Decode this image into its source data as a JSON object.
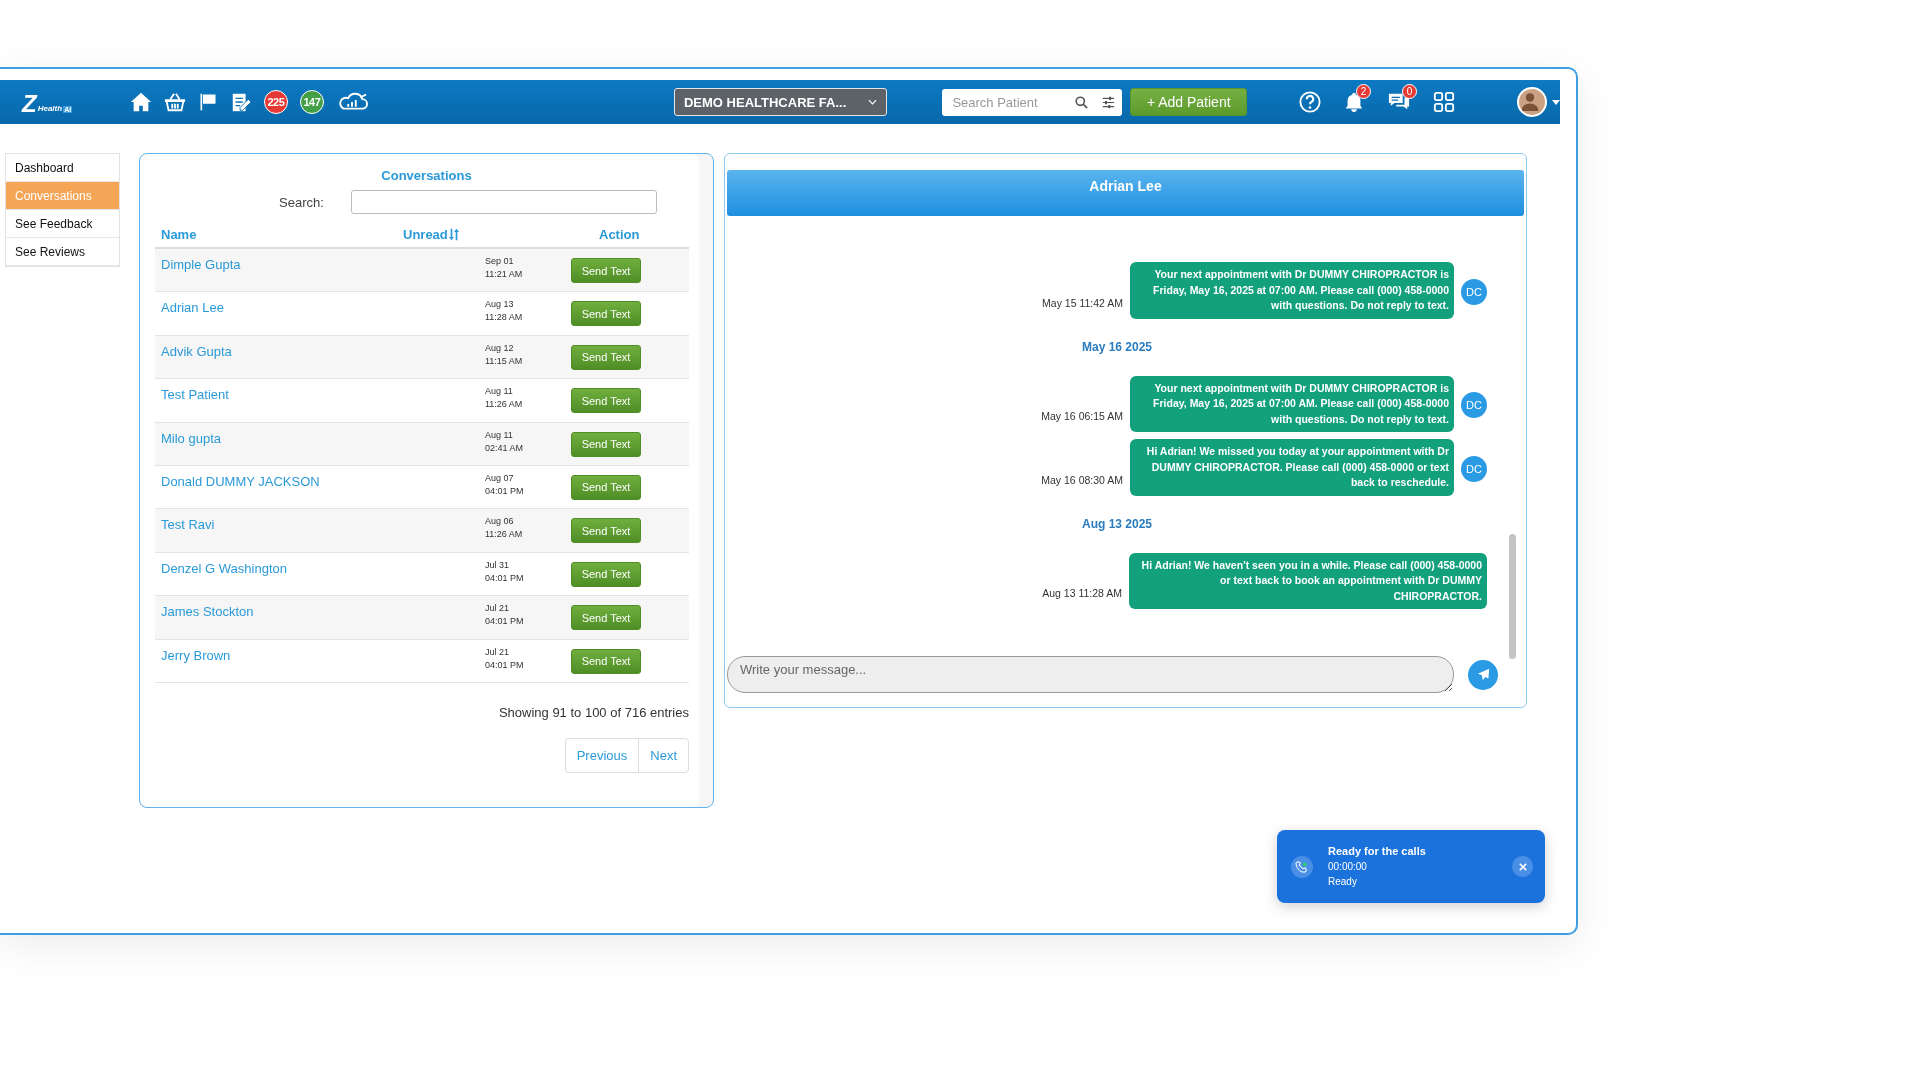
{
  "topbar": {
    "logo": {
      "mark": "Z",
      "text": "Health",
      "badge": "AI"
    },
    "nav_badges": [
      {
        "count": "225",
        "color": "#e53935"
      },
      {
        "count": "147",
        "color": "#43a047"
      }
    ],
    "facility_dropdown": "DEMO HEALTHCARE FA...",
    "search": {
      "placeholder": "Search Patient"
    },
    "add_button": "+ Add Patient",
    "notification_count": "2",
    "message_count": "0"
  },
  "sidebar": {
    "items": [
      {
        "label": "Dashboard",
        "selected": false
      },
      {
        "label": "Conversations",
        "selected": true
      },
      {
        "label": "See Feedback",
        "selected": false
      },
      {
        "label": "See Reviews",
        "selected": false
      }
    ]
  },
  "conversations": {
    "title": "Conversations",
    "search_label": "Search:",
    "columns": [
      "Name",
      "Unread",
      "Action"
    ],
    "rows": [
      {
        "name": "Dimple Gupta",
        "date": "Sep 01",
        "time": "11:21 AM",
        "action": "Send Text"
      },
      {
        "name": "Adrian Lee",
        "date": "Aug 13",
        "time": "11:28 AM",
        "action": "Send Text"
      },
      {
        "name": "Advik Gupta",
        "date": "Aug 12",
        "time": "11:15 AM",
        "action": "Send Text"
      },
      {
        "name": "Test Patient",
        "date": "Aug 11",
        "time": "11:26 AM",
        "action": "Send Text"
      },
      {
        "name": "Milo gupta",
        "date": "Aug 11",
        "time": "02:41 AM",
        "action": "Send Text"
      },
      {
        "name": "Donald DUMMY JACKSON",
        "date": "Aug 07",
        "time": "04:01 PM",
        "action": "Send Text"
      },
      {
        "name": "Test Ravi",
        "date": "Aug 06",
        "time": "11:26 AM",
        "action": "Send Text"
      },
      {
        "name": "Denzel G Washington",
        "date": "Jul 31",
        "time": "04:01 PM",
        "action": "Send Text"
      },
      {
        "name": "James Stockton",
        "date": "Jul 21",
        "time": "04:01 PM",
        "action": "Send Text"
      },
      {
        "name": "Jerry Brown",
        "date": "Jul 21",
        "time": "04:01 PM",
        "action": "Send Text"
      }
    ],
    "summary": "Showing 91 to 100 of 716 entries",
    "pagination": [
      "Previous",
      "Next"
    ]
  },
  "chat": {
    "contact": "Adrian Lee",
    "messages": [
      {
        "kind": "message",
        "time": "May 15 11:42 AM",
        "text": "Your next appointment with Dr DUMMY CHIROPRACTOR is Friday, May 16, 2025 at 07:00 AM. Please call (000) 458-0000 with questions. Do not reply to text.",
        "sender": "DC"
      },
      {
        "kind": "date",
        "text": "May 16 2025"
      },
      {
        "kind": "message",
        "time": "May 16 06:15 AM",
        "text": "Your next appointment with Dr DUMMY CHIROPRACTOR is Friday, May 16, 2025 at 07:00 AM. Please call (000) 458-0000 with questions. Do not reply to text.",
        "sender": "DC"
      },
      {
        "kind": "message",
        "time": "May 16 08:30 AM",
        "text": "Hi Adrian! We missed you today at your appointment with Dr DUMMY CHIROPRACTOR. Please call (000) 458-0000 or text back to reschedule.",
        "sender": "DC"
      },
      {
        "kind": "date",
        "text": "Aug 13 2025"
      },
      {
        "kind": "message",
        "time": "Aug 13 11:28 AM",
        "text": "Hi Adrian! We haven't seen you in a while. Please call (000) 458-0000 or text back to book an appointment with Dr DUMMY CHIROPRACTOR."
      }
    ],
    "input": {
      "placeholder": "Write your message..."
    }
  },
  "call_toast": {
    "title": "Ready for the calls",
    "timer": "00:00:00",
    "status": "Ready"
  }
}
